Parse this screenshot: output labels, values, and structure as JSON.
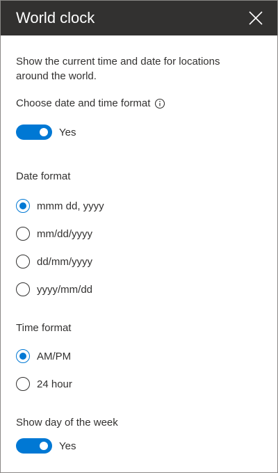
{
  "header": {
    "title": "World clock"
  },
  "description": "Show the current time and date for locations around the world.",
  "date_time_format": {
    "label": "Choose date and time format",
    "toggle_on": true,
    "toggle_label": "Yes"
  },
  "date_format": {
    "label": "Date format",
    "selected": 0,
    "options": [
      {
        "label": "mmm dd, yyyy"
      },
      {
        "label": "mm/dd/yyyy"
      },
      {
        "label": "dd/mm/yyyy"
      },
      {
        "label": "yyyy/mm/dd"
      }
    ]
  },
  "time_format": {
    "label": "Time format",
    "selected": 0,
    "options": [
      {
        "label": "AM/PM"
      },
      {
        "label": "24 hour"
      }
    ]
  },
  "day_of_week": {
    "label": "Show day of the week",
    "toggle_on": true,
    "toggle_label": "Yes"
  },
  "colors": {
    "header_bg": "#323130",
    "accent": "#0078d4",
    "text": "#323130"
  },
  "icons": {
    "close": "close-icon",
    "info": "info-icon"
  }
}
